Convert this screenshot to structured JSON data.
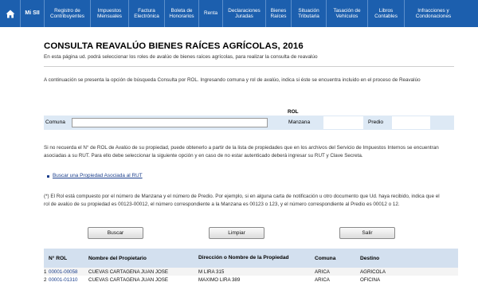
{
  "nav": {
    "home_icon": "home-icon",
    "items": [
      {
        "label": "Mi SII"
      },
      {
        "label": "Registro de Contribuyentes"
      },
      {
        "label": "Impuestos Mensuales"
      },
      {
        "label": "Factura Electrónica"
      },
      {
        "label": "Boleta de Honorarios"
      },
      {
        "label": "Renta"
      },
      {
        "label": "Declaraciones Juradas"
      },
      {
        "label": "Bienes Raíces"
      },
      {
        "label": "Situación Tributaria"
      },
      {
        "label": "Tasación de Vehículos"
      },
      {
        "label": "Libros Contables"
      },
      {
        "label": "Infracciones y Condonaciones"
      }
    ]
  },
  "page": {
    "title": "CONSULTA REAVALÚO BIENES RAÍCES  AGRÍCOLAS, 2016",
    "subtitle": "En esta página ud. podrá seleccionar los roles de avalúo de bienes raíces agrícolas, para realizar la consulta de reavalúo",
    "intro": "A continuación se presenta la opción de búsqueda Consulta por ROL. Ingresando comuna y rol de avalúo, indica si éste se encuentra incluido en el proceso de Reavalúo"
  },
  "form": {
    "rol_header": "ROL",
    "comuna_label": "Comuna",
    "comuna_value": "",
    "manzana_label": "Manzana",
    "manzana_value": "",
    "predio_label": "Predio",
    "predio_value": ""
  },
  "help": {
    "text": "Si no recuerda el N° de ROL de Avalúo de su propiedad, puede obtenerlo a partir de la lista de propiedades que en los archivos del Servicio de Impuestos Internos se encuentran asociadas a su RUT. Para ello debe seleccionar la siguiente opción y en caso de no estar autenticado deberá ingresar su RUT y Clave Secreta.",
    "link": "Buscar una Propiedad Asociada al RUT"
  },
  "note": "(*) El Rol está compuesto por el número de Manzana y el número de Predio. Por ejemplo, si en alguna carta de notificación u otro documento que Ud. haya recibido, indica que el rol de avalúo de su propiedad es 00123-00012, el número correspondiente a la Manzana es 00123 o 123, y el número correspondiente al Predio es 00012 o 12.",
  "buttons": {
    "buscar": "Buscar",
    "limpiar": "Limpiar",
    "salir": "Salir"
  },
  "table": {
    "headers": {
      "rol": "N° ROL",
      "owner": "Nombre del Propietario",
      "address": "Dirección o Nombre de la Propiedad",
      "comuna": "Comuna",
      "destino": "Destino"
    },
    "rows": [
      {
        "num": "1",
        "rol": "00001-00058",
        "owner": "CUEVAS CARTAGENA JUAN JOSE",
        "address": "M LIRA 315",
        "comuna": "ARICA",
        "destino": "AGRICOLA"
      },
      {
        "num": "2",
        "rol": "00001-01310",
        "owner": "CUEVAS CARTAGENA JUAN JOSE",
        "address": "MAXIMO LIRA 389",
        "comuna": "ARICA",
        "destino": "OFICINA"
      }
    ]
  }
}
